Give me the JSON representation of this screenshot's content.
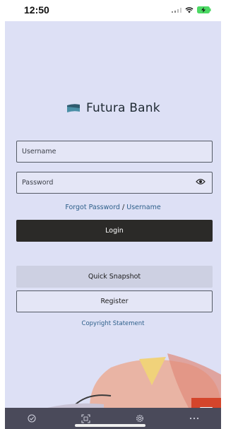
{
  "status_bar": {
    "time": "12:50",
    "icons": [
      "signal-icon",
      "wifi-icon",
      "battery-charging-icon"
    ]
  },
  "brand": {
    "name": "Futura Bank",
    "logo_icon": "futura-bank-logo",
    "logo_color": "#2e5a6e"
  },
  "login_form": {
    "username_placeholder": "Username",
    "password_placeholder": "Password",
    "username_value": "",
    "password_value": "",
    "show_password_icon": "eye-icon",
    "forgot_password_label": "Forgot Password",
    "forgot_separator": "/",
    "forgot_username_label": "Username",
    "login_label": "Login"
  },
  "actions": {
    "quick_snapshot_label": "Quick Snapshot",
    "register_label": "Register",
    "copyright_label": "Copyright Statement"
  },
  "chat": {
    "icon": "chat-bubble-icon",
    "color": "#d4452b"
  },
  "tab_bar": {
    "items": [
      {
        "icon": "check-circle-icon"
      },
      {
        "icon": "scan-qr-icon"
      },
      {
        "icon": "gear-icon"
      },
      {
        "icon": "more-icon"
      }
    ]
  },
  "colors": {
    "background": "#dde0f5",
    "login_button": "#2b2a28",
    "link": "#2d5f8a",
    "tab_bar": "#4a4a5a"
  }
}
